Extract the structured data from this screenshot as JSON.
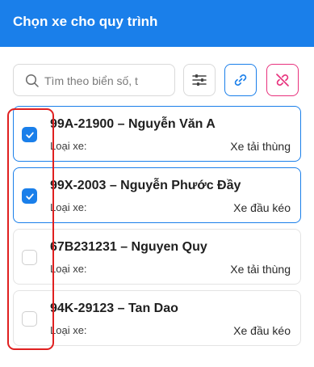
{
  "header": {
    "title": "Chọn xe cho quy trình"
  },
  "search": {
    "placeholder": "Tìm theo biển số, t",
    "value": ""
  },
  "toolbar": {
    "filter_icon": "sliders-icon",
    "link_icon": "link-icon",
    "unlink_icon": "unlink-icon"
  },
  "colors": {
    "primary": "#1a7fea",
    "danger": "#e8327d",
    "highlight": "#e02020"
  },
  "vehicles": [
    {
      "title": "99A-21900 – Nguyễn Văn A",
      "type_label": "Loại xe:",
      "type_value": "Xe tải thùng",
      "checked": true
    },
    {
      "title": "99X-2003 – Nguyễn Phước Đầy",
      "type_label": "Loại xe:",
      "type_value": "Xe đầu kéo",
      "checked": true
    },
    {
      "title": "67B231231 – Nguyen Quy",
      "type_label": "Loại xe:",
      "type_value": "Xe tải thùng",
      "checked": false
    },
    {
      "title": "94K-29123 – Tan Dao",
      "type_label": "Loại xe:",
      "type_value": "Xe đầu kéo",
      "checked": false
    }
  ]
}
